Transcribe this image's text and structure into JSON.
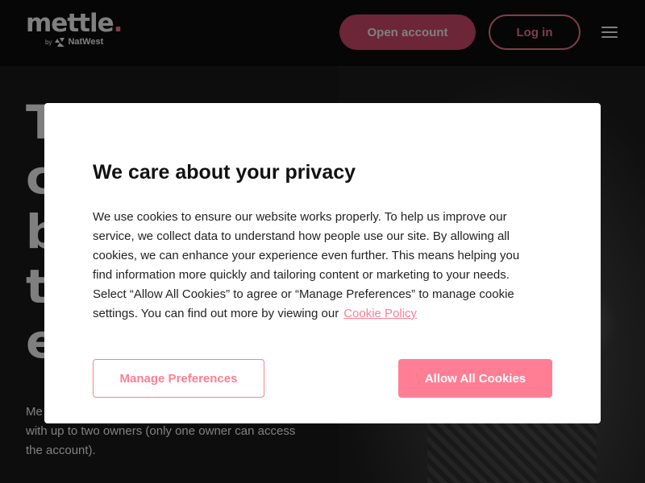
{
  "header": {
    "logo_text": "mettle",
    "logo_dot": ".",
    "logo_by": "by",
    "logo_partner": "NatWest",
    "open_account_label": "Open account",
    "login_label": "Log in"
  },
  "hero": {
    "heading_lines": [
      "T",
      "c",
      "b",
      "t",
      "e"
    ],
    "body_lines": [
      "Me",
      "with up to two owners (only one owner can access",
      "the account)."
    ]
  },
  "cookie_modal": {
    "title": "We care about your privacy",
    "body_lines": [
      "We use cookies to ensure our website works properly. To help us improve our",
      "service, we collect data to understand how people use our site. By allowing all",
      "cookies, we can enhance your experience even further. This means helping you",
      "find information more quickly and tailoring content or marketing to your needs.",
      "Select “Allow All Cookies” to agree or “Manage Preferences” to manage cookie",
      "settings. You can find out more by viewing our"
    ],
    "link_label": "Cookie Policy",
    "manage_label": "Manage Preferences",
    "allow_label": "Allow All Cookies"
  },
  "colors": {
    "accent": "#ff7e94",
    "header_bg": "#0d0d0d",
    "page_bg": "#1b1b1b"
  },
  "icons": {
    "menu": "hamburger-menu-icon",
    "partner": "natwest-logo-icon"
  }
}
